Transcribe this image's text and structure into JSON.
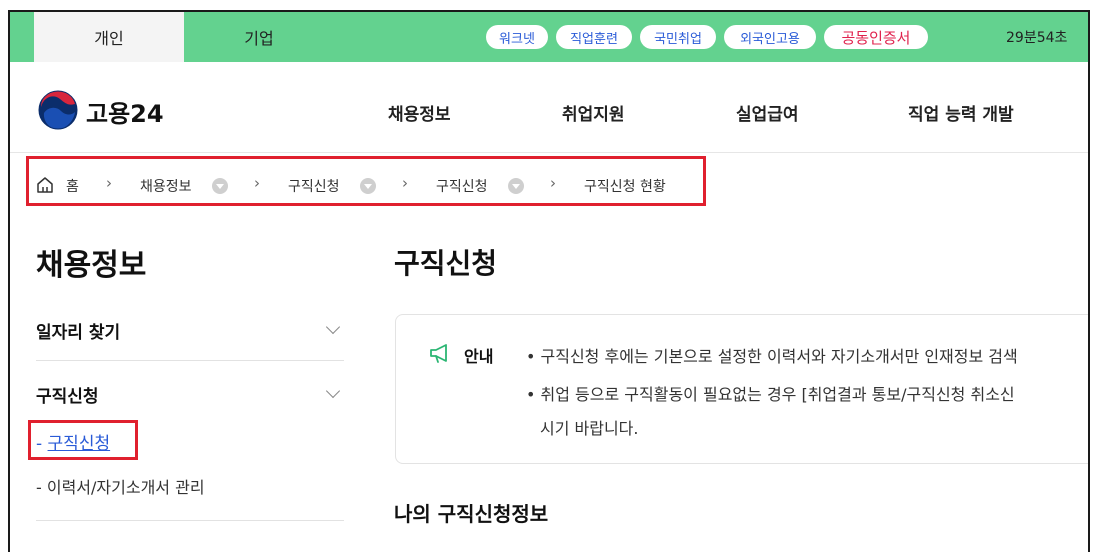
{
  "topbar": {
    "tabs": [
      {
        "label": "개인",
        "active": true
      },
      {
        "label": "기업",
        "active": false
      }
    ],
    "quick_links": [
      "워크넷",
      "직업훈련",
      "국민취업",
      "외국인고용",
      "공동인증서"
    ],
    "session_timer": "29분54초"
  },
  "header": {
    "logo_text": "고용24",
    "nav": [
      "채용정보",
      "취업지원",
      "실업급여",
      "직업 능력 개발"
    ]
  },
  "breadcrumb": {
    "home": "홈",
    "items": [
      "채용정보",
      "구직신청",
      "구직신청",
      "구직신청 현황"
    ]
  },
  "sidebar": {
    "title": "채용정보",
    "sections": [
      {
        "label": "일자리 찾기"
      },
      {
        "label": "구직신청"
      }
    ],
    "subitems": [
      "구직신청",
      "이력서/자기소개서 관리"
    ]
  },
  "main": {
    "title": "구직신청",
    "notice": {
      "label": "안내",
      "lines": [
        "• 구직신청 후에는 기본으로 설정한 이력서와 자기소개서만 인재정보 검색",
        "• 취업 등으로 구직활동이 필요없는 경우 [취업결과 통보/구직신청 취소신",
        "시기 바랍니다."
      ]
    },
    "section_title": "나의 구직신청정보"
  },
  "colors": {
    "brand_green": "#63d28f",
    "highlight_red": "#e0202e",
    "link_blue": "#2a5bd7"
  }
}
